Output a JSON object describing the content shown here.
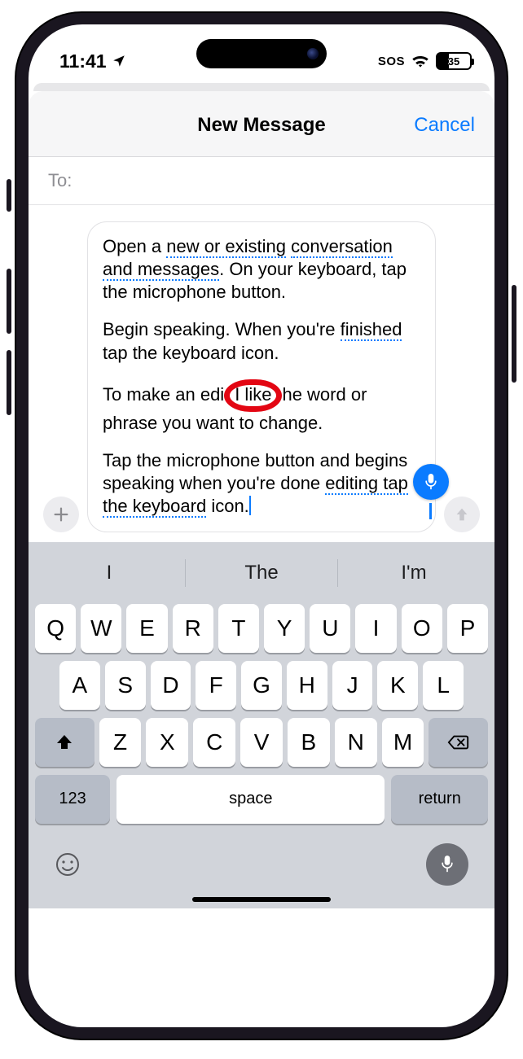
{
  "status": {
    "time": "11:41",
    "sos": "SOS",
    "battery": "35"
  },
  "nav": {
    "title": "New Message",
    "cancel": "Cancel"
  },
  "to": {
    "label": "To:"
  },
  "message": {
    "p1a": "Open a ",
    "p1u1": "new or existing",
    "p1b": " ",
    "p1u2": "conversation and messages",
    "p1c": ". On your keyboard, tap the microphone button.",
    "p2a": "Begin speaking. When you're ",
    "p2u": "finished",
    "p2b": " tap the keyboard icon.",
    "p3a": "To make an edi",
    "p3circle": "I like",
    "p3b": "he word or phrase you want to change.",
    "p4a": "Tap the microphone button and begins speaking when you're done ",
    "p4u": "editing tap the keyboard",
    "p4b": " icon."
  },
  "predictions": [
    "I",
    "The",
    "I'm"
  ],
  "keys_row1": [
    "Q",
    "W",
    "E",
    "R",
    "T",
    "Y",
    "U",
    "I",
    "O",
    "P"
  ],
  "keys_row2": [
    "A",
    "S",
    "D",
    "F",
    "G",
    "H",
    "J",
    "K",
    "L"
  ],
  "keys_row3": [
    "Z",
    "X",
    "C",
    "V",
    "B",
    "N",
    "M"
  ],
  "keys_bottom": {
    "num": "123",
    "space": "space",
    "ret": "return"
  }
}
